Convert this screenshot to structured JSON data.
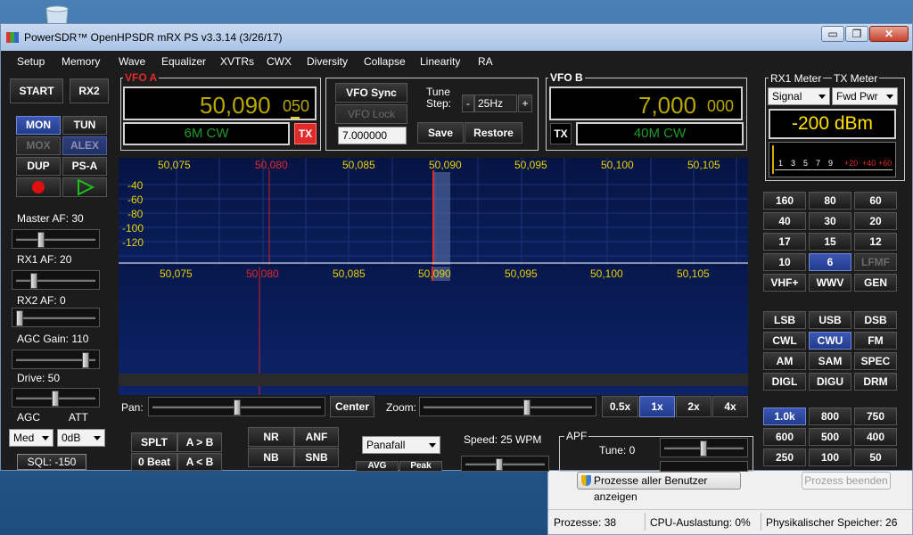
{
  "taskmgr": {
    "show_all_label": "Prozesse aller Benutzer anzeigen",
    "end_process_label": "Prozess beenden",
    "status_processes": "Prozesse: 38",
    "status_cpu": "CPU-Auslastung: 0%",
    "status_mem": "Physikalischer Speicher: 26"
  },
  "window": {
    "title": "PowerSDR™ OpenHPSDR mRX PS v3.3.14 (3/26/17)",
    "minimize": "▭",
    "restore": "❐",
    "close": "✕"
  },
  "menu": [
    "Setup",
    "Memory",
    "Wave",
    "Equalizer",
    "XVTRs",
    "CWX",
    "Diversity",
    "Collapse",
    "Linearity",
    "RA"
  ],
  "left": {
    "start": "START",
    "rx2": "RX2",
    "mon": "MON",
    "tun": "TUN",
    "mox": "MOX",
    "alex": "ALEX",
    "dup": "DUP",
    "psa": "PS-A",
    "master_af": "Master AF:  30",
    "master_af_value": 30,
    "rx1_af": "RX1 AF:  20",
    "rx1_af_value": 20,
    "rx2_af": "RX2 AF:  0",
    "rx2_af_value": 0,
    "agc_gain": "AGC Gain:  110",
    "agc_gain_value": 110,
    "drive": "Drive:  50",
    "drive_value": 50,
    "agc_label": "AGC",
    "att_label": "ATT",
    "agc_value": "Med",
    "att_value": "0dB",
    "sql": "SQL: -150"
  },
  "vfoa": {
    "title": "VFO A",
    "freq_main": "50,090",
    "freq_sub": "050",
    "mode": "6M CW",
    "tx": "TX"
  },
  "mid": {
    "vfo_sync": "VFO Sync",
    "vfo_lock": "VFO Lock",
    "freq_field": "7.000000",
    "tune_step_label": "Tune\nStep:",
    "tune_step_minus": "-",
    "tune_step_value": "25Hz",
    "tune_step_plus": "+",
    "save": "Save",
    "restore": "Restore"
  },
  "vfob": {
    "title": "VFO B",
    "freq_main": "7,000",
    "freq_sub": "000",
    "mode": "40M CW",
    "tx": "TX"
  },
  "meter": {
    "rx1_label": "RX1 Meter",
    "tx_label": "TX Meter",
    "rx1_select": "Signal",
    "tx_select": "Fwd Pwr",
    "reading": "-200 dBm",
    "scale": [
      "1",
      "3",
      "5",
      "7",
      "9",
      "+20",
      "+40",
      "+60"
    ]
  },
  "display": {
    "scale_labels": [
      "50,075",
      "50,080",
      "50,085",
      "50,090",
      "50,095",
      "50,100",
      "50,105"
    ],
    "db_labels": [
      "-40",
      "-60",
      "-80",
      "-100",
      "-120"
    ],
    "pan_label": "Pan:",
    "pan_value": 0.5,
    "center": "Center",
    "zoom_label": "Zoom:",
    "zoom_value": 0.6,
    "zoom_buttons": [
      "0.5x",
      "1x",
      "2x",
      "4x"
    ],
    "zoom_selected": "1x"
  },
  "bands": [
    "160",
    "80",
    "60",
    "40",
    "30",
    "20",
    "17",
    "15",
    "12",
    "10",
    "6",
    "LFMF",
    "VHF+",
    "WWV",
    "GEN"
  ],
  "band_selected": "6",
  "modes": [
    "LSB",
    "USB",
    "DSB",
    "CWL",
    "CWU",
    "FM",
    "AM",
    "SAM",
    "SPEC",
    "DIGL",
    "DIGU",
    "DRM"
  ],
  "mode_selected": "CWU",
  "filters": [
    "1.0k",
    "800",
    "750",
    "600",
    "500",
    "400",
    "250",
    "100",
    "50"
  ],
  "filter_selected": "1.0k",
  "bottom": {
    "splt": "SPLT",
    "a_to_b": "A > B",
    "zero_beat": "0 Beat",
    "a_lt_b": "A < B",
    "nr": "NR",
    "anf": "ANF",
    "nb": "NB",
    "snb": "SNB",
    "display_mode": "Panafall",
    "avg": "AVG",
    "peak": "Peak",
    "speed": "Speed:  25 WPM",
    "apf_title": "APF",
    "apf_tune": "Tune:  0"
  },
  "colors": {
    "accent_blue": "#223c8c",
    "vfo_yellow": "#b9a800",
    "mode_green": "#1f9a2a",
    "tx_red": "#e02b2b"
  }
}
